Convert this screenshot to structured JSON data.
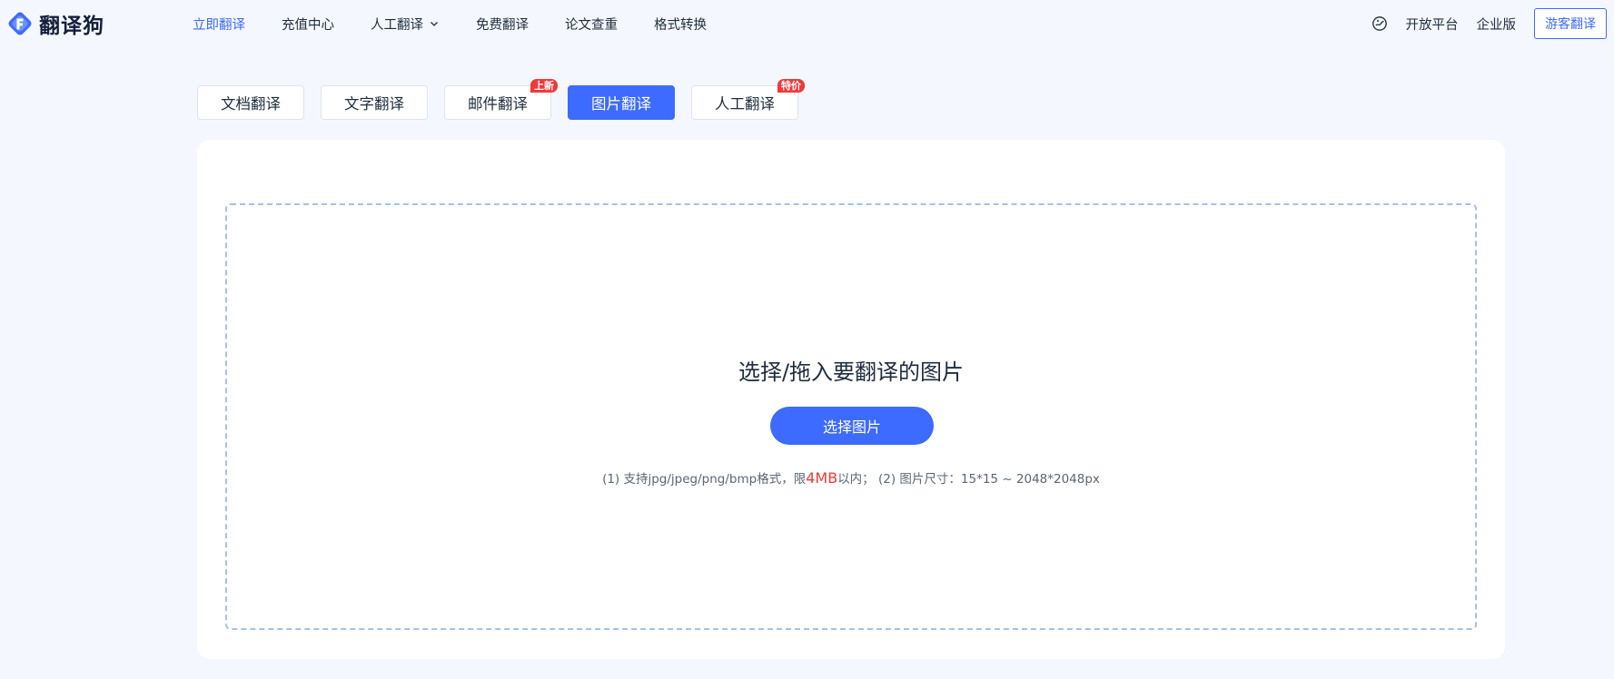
{
  "brand": {
    "name": "翻译狗",
    "logo_icon": "fanyigou-logo-icon",
    "accent_color": "#3d6bff"
  },
  "nav": {
    "items": [
      {
        "label": "立即翻译",
        "active": true
      },
      {
        "label": "充值中心"
      },
      {
        "label": "人工翻译",
        "dropdown": true
      },
      {
        "label": "免费翻译"
      },
      {
        "label": "论文查重"
      },
      {
        "label": "格式转换"
      }
    ]
  },
  "nav_right": {
    "theme_icon": "palette-icon",
    "open_platform": "开放平台",
    "enterprise": "企业版",
    "guest_button": "游客翻译"
  },
  "tabs": [
    {
      "label": "文档翻译"
    },
    {
      "label": "文字翻译"
    },
    {
      "label": "邮件翻译",
      "badge": "上新"
    },
    {
      "label": "图片翻译",
      "active": true
    },
    {
      "label": "人工翻译",
      "badge": "特价"
    }
  ],
  "upload": {
    "title": "选择/拖入要翻译的图片",
    "button": "选择图片",
    "hint_prefix": "(1) 支持jpg/jpeg/png/bmp格式，限",
    "hint_highlight": "4MB",
    "hint_suffix": "以内； (2) 图片尺寸：15*15 ~ 2048*2048px",
    "highlight_color": "#f0393a"
  }
}
